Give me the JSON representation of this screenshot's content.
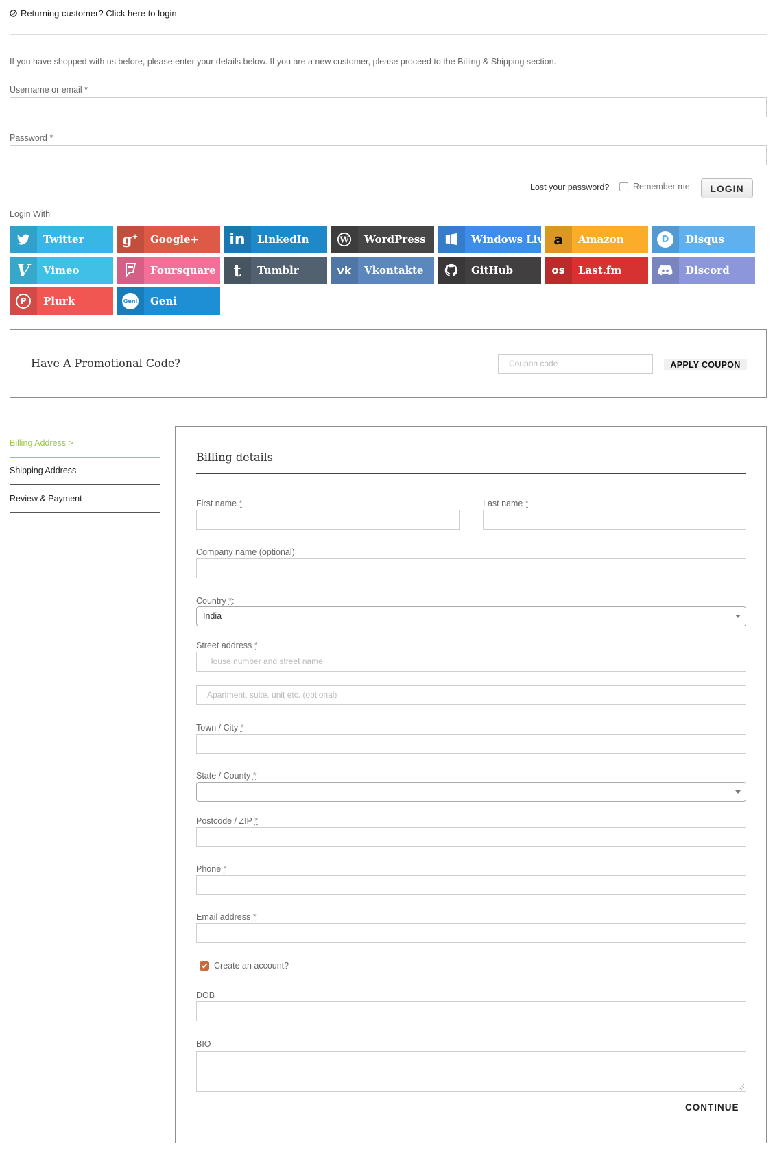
{
  "returning": {
    "text": "Returning customer? Click here to login"
  },
  "login": {
    "intro": "If you have shopped with us before, please enter your details below. If you are a new customer, please proceed to the Billing & Shipping section.",
    "username_label": "Username or email *",
    "password_label": "Password *",
    "lost_password": "Lost your password?",
    "remember_me": "Remember me",
    "login_button": "LOGIN",
    "login_with": "Login With"
  },
  "social": [
    {
      "label": "Twitter",
      "color": "#38b7e7",
      "icon": "twitter-icon"
    },
    {
      "label": "Google+",
      "color": "#dd5a47",
      "icon": "google-plus-icon"
    },
    {
      "label": "LinkedIn",
      "color": "#1e88c8",
      "icon": "linkedin-icon"
    },
    {
      "label": "WordPress",
      "color": "#464646",
      "icon": "wordpress-icon"
    },
    {
      "label": "Windows Live",
      "color": "#3d8ee8",
      "icon": "windows-icon"
    },
    {
      "label": "Amazon",
      "color": "#fbac28",
      "icon": "amazon-icon"
    },
    {
      "label": "Disqus",
      "color": "#5fb0ef",
      "icon": "disqus-icon"
    },
    {
      "label": "Vimeo",
      "color": "#3fc0e6",
      "icon": "vimeo-icon"
    },
    {
      "label": "Foursquare",
      "color": "#f26f98",
      "icon": "foursquare-icon"
    },
    {
      "label": "Tumblr",
      "color": "#51616f",
      "icon": "tumblr-icon"
    },
    {
      "label": "Vkontakte",
      "color": "#5c87bd",
      "icon": "vk-icon"
    },
    {
      "label": "GitHub",
      "color": "#413f3f",
      "icon": "github-icon"
    },
    {
      "label": "Last.fm",
      "color": "#d73232",
      "icon": "lastfm-icon"
    },
    {
      "label": "Discord",
      "color": "#8b97da",
      "icon": "discord-icon"
    },
    {
      "label": "Plurk",
      "color": "#f15652",
      "icon": "plurk-icon"
    },
    {
      "label": "Geni",
      "color": "#1e8fd5",
      "icon": "geni-icon"
    }
  ],
  "promo": {
    "title": "Have A Promotional Code?",
    "coupon_placeholder": "Coupon code",
    "apply_label": "APPLY COUPON"
  },
  "steps": [
    {
      "label": "Billing Address >"
    },
    {
      "label": "Shipping Address"
    },
    {
      "label": "Review & Payment"
    }
  ],
  "billing": {
    "title": "Billing details",
    "first_name": "First name",
    "last_name": "Last name",
    "company": "Company name (optional)",
    "country_label": "Country",
    "country_value": "India",
    "street": "Street address",
    "street_placeholder_1": "House number and street name",
    "street_placeholder_2": "Apartment, suite, unit etc. (optional)",
    "city": "Town / City",
    "state": "State / County",
    "postcode": "Postcode / ZIP",
    "phone": "Phone",
    "email": "Email address",
    "create_account": "Create an account?",
    "create_account_checked": true,
    "dob": "DOB",
    "bio": "BIO",
    "continue": "CONTINUE"
  }
}
